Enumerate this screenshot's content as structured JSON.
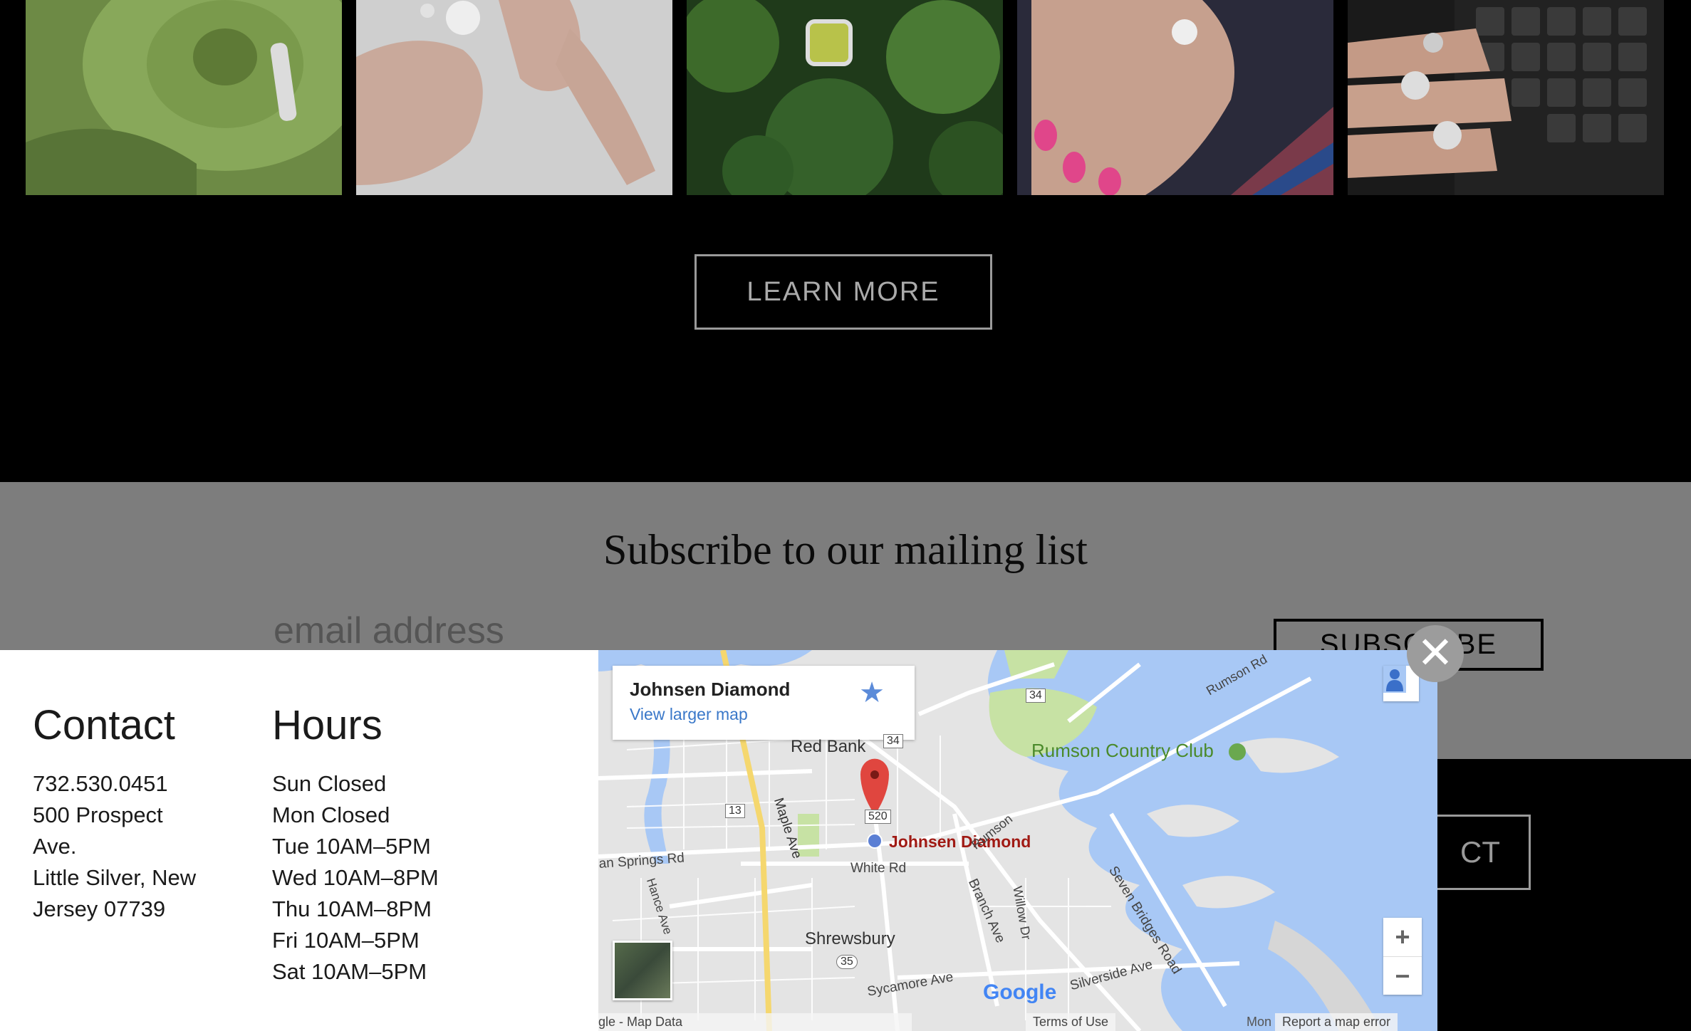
{
  "learn_more": {
    "label": "LEARN MORE"
  },
  "subscribe": {
    "title": "Subscribe to our mailing list",
    "email_placeholder": "email address",
    "button_label": "SUBSCRIBE"
  },
  "contact_button": {
    "label": "CONTACT",
    "visible_fragment": "CT"
  },
  "modal": {
    "close_label": "✕",
    "contact": {
      "title": "Contact",
      "lines": [
        "732.530.0451",
        "500 Prospect",
        "Ave.",
        "Little Silver, New",
        "Jersey 07739"
      ]
    },
    "hours": {
      "title": "Hours",
      "lines": [
        "Sun Closed",
        "Mon Closed",
        "Tue 10AM–5PM",
        "Wed 10AM–8PM",
        "Thu 10AM–8PM",
        "Fri 10AM–5PM",
        "Sat 10AM–5PM"
      ]
    }
  },
  "map": {
    "card_name": "Johnsen Diamond",
    "card_link": "View larger map",
    "pin_label": "Johnsen Diamond",
    "places": {
      "red_bank": "Red Bank",
      "rumson_cc": "Rumson Country Club",
      "shrewsbury": "Shrewsbury"
    },
    "roads": {
      "maple": "Maple Ave",
      "white": "White Rd",
      "branch": "Branch Ave",
      "willow": "Willow Dr",
      "seven_bridges": "Seven Bridges Road",
      "sycamore": "Sycamore Ave",
      "silverside": "Silverside Ave",
      "hance": "Hance Ave",
      "springs": "an Springs Rd",
      "rumson_rd": "Rumson Rd",
      "rumson": "Rumson",
      "route_34a": "34",
      "route_34b": "34",
      "route_13": "13",
      "route_520": "520",
      "route_35": "35"
    },
    "attribution": {
      "google": "Google",
      "map_data": "gle - Map Data",
      "terms": "Terms of Use",
      "report": "Report a map error",
      "mon": "Mon"
    },
    "zoom_in": "+",
    "zoom_out": "−"
  },
  "gallery": {
    "images": [
      "succulent-ring-photo",
      "hand-ring-photo",
      "green-gem-ring-photo",
      "pink-nails-ring-photo",
      "keyboard-rings-photo"
    ]
  },
  "colors": {
    "overlay": "#7d7d7d",
    "map_water": "#a8c8f5",
    "pin": "#e0463f",
    "link": "#3a78c9"
  }
}
